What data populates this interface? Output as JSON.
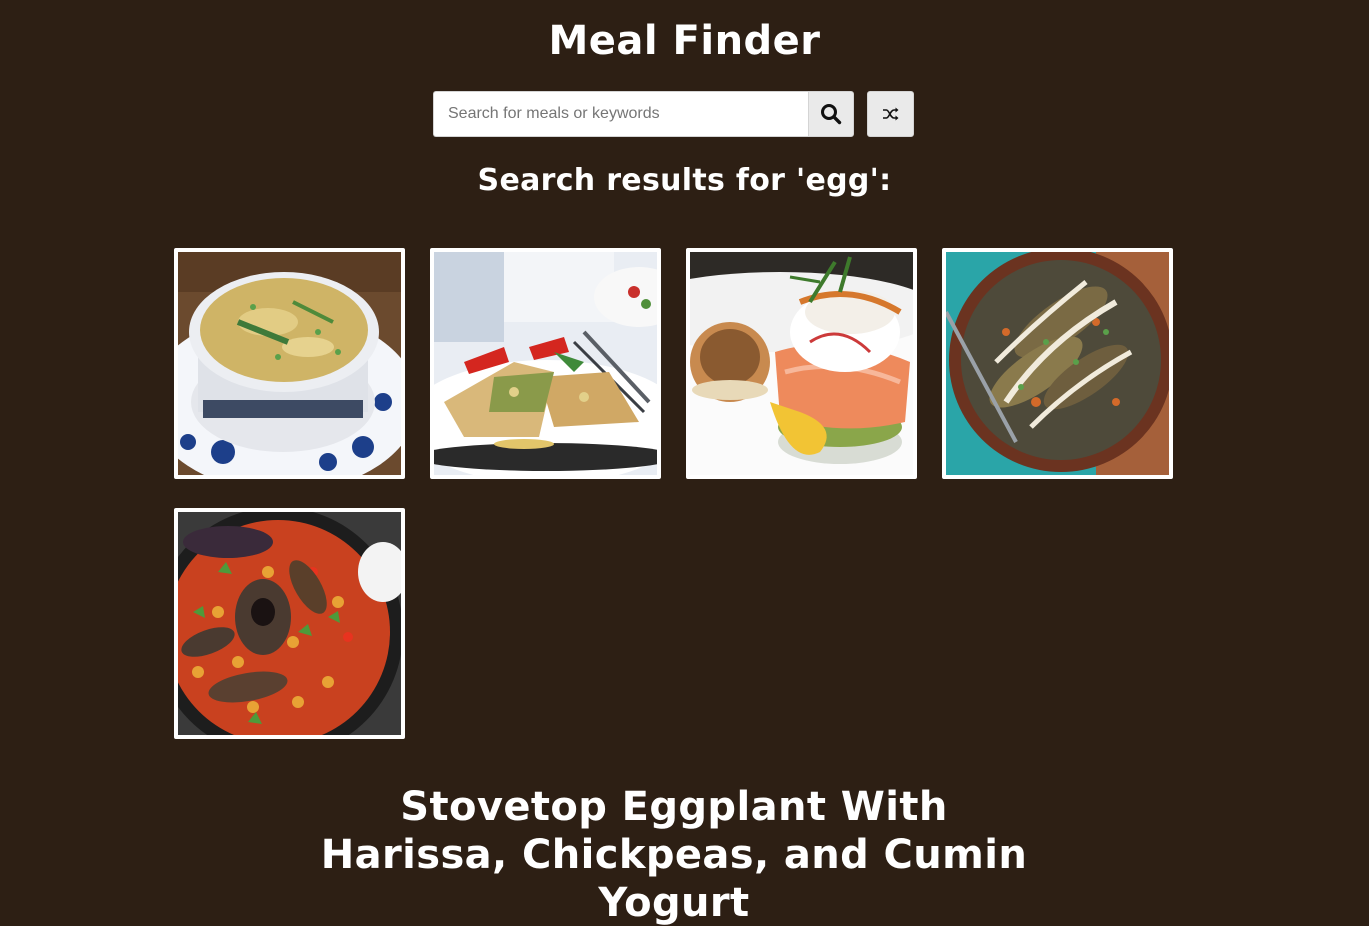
{
  "app": {
    "title": "Meal Finder"
  },
  "search": {
    "placeholder": "Search for meals or keywords",
    "value": "",
    "search_icon": "search-icon",
    "random_icon": "shuffle-icon"
  },
  "results": {
    "heading": "Search results for 'egg':",
    "meals": [
      {
        "image": "egg-drop-soup-in-blue-white-bowl"
      },
      {
        "image": "egg-roll-wrap-with-peppers-on-plate"
      },
      {
        "image": "smoked-salmon-eggs-benedict"
      },
      {
        "image": "lentil-eggplant-dish-with-yogurt-drizzle"
      },
      {
        "image": "stovetop-eggplant-chickpeas-in-skillet"
      }
    ]
  },
  "selected_meal": {
    "title": "Stovetop Eggplant With Harissa, Chickpeas, and Cumin Yogurt"
  },
  "colors": {
    "background": "#2d1f14",
    "text": "#ffffff",
    "button_bg": "#eaeaea"
  }
}
